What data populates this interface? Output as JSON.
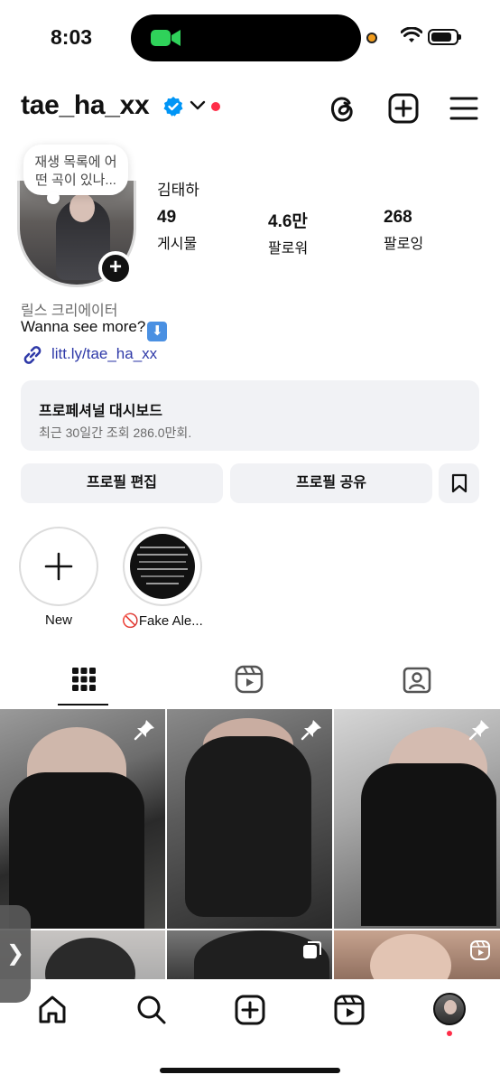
{
  "status_bar": {
    "time": "8:03"
  },
  "header": {
    "username": "tae_ha_xx",
    "icons": [
      "verified-badge-icon",
      "chevron-down-icon",
      "threads-icon",
      "create-post-icon",
      "menu-icon"
    ]
  },
  "profile": {
    "note": "재생 목록에 어떤 곡이 있나...",
    "full_name": "김태하",
    "stats": [
      {
        "value": "49",
        "label": "게시물"
      },
      {
        "value": "4.6만",
        "label": "팔로워"
      },
      {
        "value": "268",
        "label": "팔로잉"
      }
    ],
    "category": "릴스 크리에이터",
    "bio": "Wanna see more?",
    "bio_emoji": "⬇",
    "link": "litt.ly/tae_ha_xx"
  },
  "dashboard": {
    "title": "프로페셔널 대시보드",
    "subtitle": "최근 30일간 조회 286.0만회."
  },
  "buttons": {
    "edit_profile": "프로필 편집",
    "share_profile": "프로필 공유"
  },
  "highlights": [
    {
      "label": "New",
      "type": "new"
    },
    {
      "label": "🚫Fake Ale...",
      "type": "story"
    }
  ],
  "tabs": [
    "grid-icon",
    "reels-icon",
    "tagged-icon"
  ],
  "grid": {
    "posts": [
      {
        "badge": "pin-icon"
      },
      {
        "badge": "pin-icon"
      },
      {
        "badge": "pin-icon"
      },
      {
        "badge": ""
      },
      {
        "badge": "carousel-icon"
      },
      {
        "badge": "reels-icon"
      }
    ]
  },
  "bottom_nav": [
    "home-icon",
    "search-icon",
    "create-icon",
    "reels-icon",
    "profile-avatar"
  ],
  "colors": {
    "accent_blue": "#0095f6",
    "link": "#2f3aa8",
    "notification_red": "#ff2d48",
    "button_bg": "#f1f2f5"
  }
}
